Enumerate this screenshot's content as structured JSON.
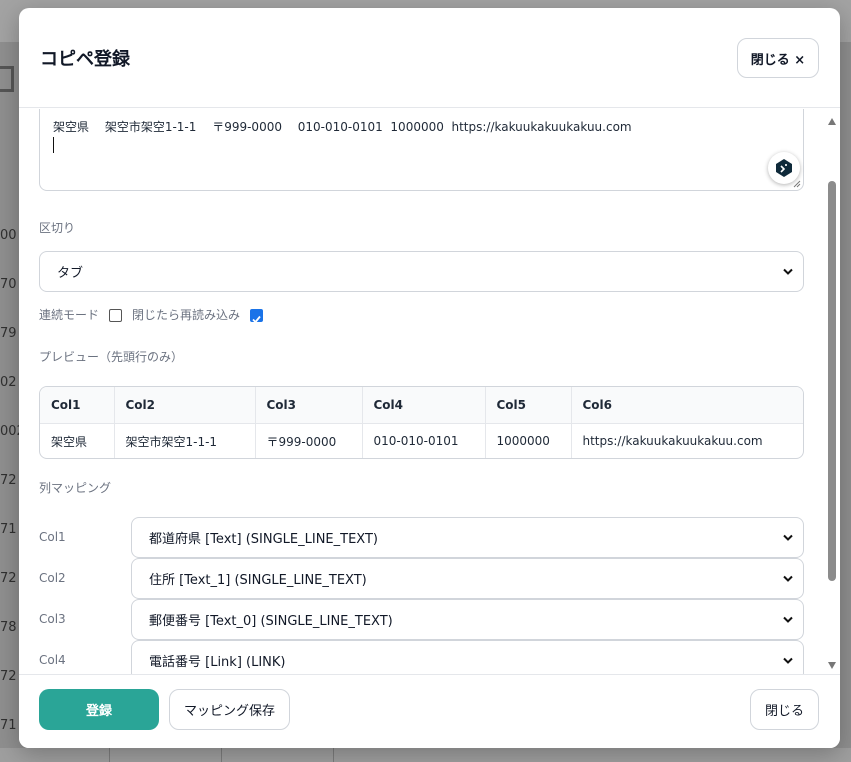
{
  "background": {
    "row_numbers": [
      "00",
      "70",
      "79",
      "02",
      "002",
      "72",
      "71",
      "72",
      "78",
      "72",
      "71"
    ]
  },
  "modal": {
    "title": "コピペ登録",
    "close_top_label": "閉じる ×",
    "paste_text": "架空県　 架空市架空1-1-1　 〒999-0000　 010-010-0101  1000000  https://kakuukakuukakuu.com",
    "delimiter": {
      "label": "区切り",
      "selected": "タブ"
    },
    "continuous_mode": {
      "label": "連続モード",
      "checked": false
    },
    "reload_on_close": {
      "label": "閉じたら再読み込み",
      "checked": true
    },
    "preview": {
      "label": "プレビュー（先頭行のみ）",
      "headers": [
        "Col1",
        "Col2",
        "Col3",
        "Col4",
        "Col5",
        "Col6"
      ],
      "row": [
        "架空県",
        "架空市架空1-1-1",
        "〒999-0000",
        "010-010-0101",
        "1000000",
        "https://kakuukakuukakuu.com"
      ]
    },
    "mapping": {
      "label": "列マッピング",
      "rows": [
        {
          "col": "Col1",
          "field": "都道府県 [Text] (SINGLE_LINE_TEXT)"
        },
        {
          "col": "Col2",
          "field": "住所 [Text_1] (SINGLE_LINE_TEXT)"
        },
        {
          "col": "Col3",
          "field": "郵便番号 [Text_0] (SINGLE_LINE_TEXT)"
        },
        {
          "col": "Col4",
          "field": "電話番号 [Link] (LINK)"
        }
      ]
    },
    "footer": {
      "register_label": "登録",
      "save_mapping_label": "マッピング保存",
      "close_label": "閉じる"
    }
  },
  "colors": {
    "primary": "#2aa597",
    "checkbox_checked": "#1a73e8"
  }
}
